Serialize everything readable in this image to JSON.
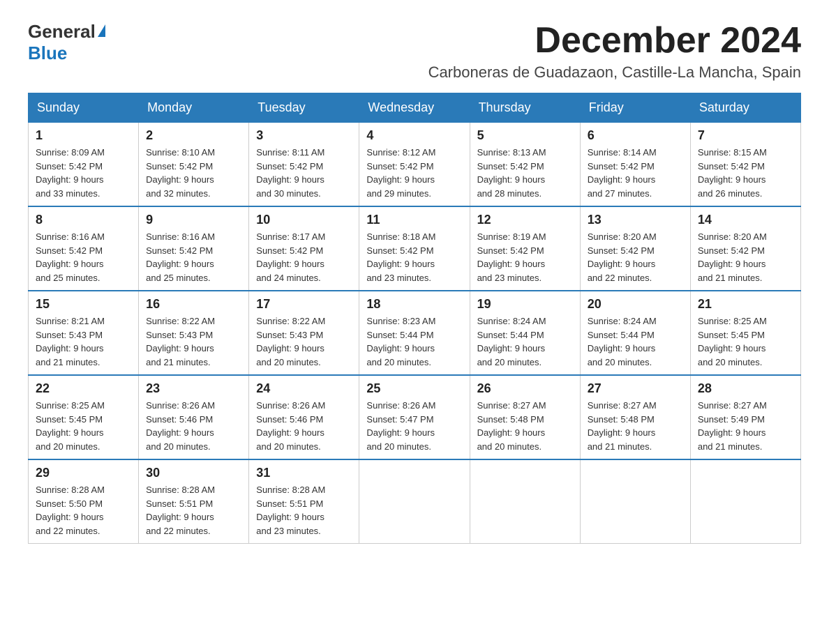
{
  "logo": {
    "general": "General",
    "blue": "Blue"
  },
  "header": {
    "title": "December 2024",
    "location": "Carboneras de Guadazaon, Castille-La Mancha, Spain"
  },
  "weekdays": [
    "Sunday",
    "Monday",
    "Tuesday",
    "Wednesday",
    "Thursday",
    "Friday",
    "Saturday"
  ],
  "weeks": [
    [
      {
        "day": "1",
        "sunrise": "8:09 AM",
        "sunset": "5:42 PM",
        "daylight": "9 hours and 33 minutes."
      },
      {
        "day": "2",
        "sunrise": "8:10 AM",
        "sunset": "5:42 PM",
        "daylight": "9 hours and 32 minutes."
      },
      {
        "day": "3",
        "sunrise": "8:11 AM",
        "sunset": "5:42 PM",
        "daylight": "9 hours and 30 minutes."
      },
      {
        "day": "4",
        "sunrise": "8:12 AM",
        "sunset": "5:42 PM",
        "daylight": "9 hours and 29 minutes."
      },
      {
        "day": "5",
        "sunrise": "8:13 AM",
        "sunset": "5:42 PM",
        "daylight": "9 hours and 28 minutes."
      },
      {
        "day": "6",
        "sunrise": "8:14 AM",
        "sunset": "5:42 PM",
        "daylight": "9 hours and 27 minutes."
      },
      {
        "day": "7",
        "sunrise": "8:15 AM",
        "sunset": "5:42 PM",
        "daylight": "9 hours and 26 minutes."
      }
    ],
    [
      {
        "day": "8",
        "sunrise": "8:16 AM",
        "sunset": "5:42 PM",
        "daylight": "9 hours and 25 minutes."
      },
      {
        "day": "9",
        "sunrise": "8:16 AM",
        "sunset": "5:42 PM",
        "daylight": "9 hours and 25 minutes."
      },
      {
        "day": "10",
        "sunrise": "8:17 AM",
        "sunset": "5:42 PM",
        "daylight": "9 hours and 24 minutes."
      },
      {
        "day": "11",
        "sunrise": "8:18 AM",
        "sunset": "5:42 PM",
        "daylight": "9 hours and 23 minutes."
      },
      {
        "day": "12",
        "sunrise": "8:19 AM",
        "sunset": "5:42 PM",
        "daylight": "9 hours and 23 minutes."
      },
      {
        "day": "13",
        "sunrise": "8:20 AM",
        "sunset": "5:42 PM",
        "daylight": "9 hours and 22 minutes."
      },
      {
        "day": "14",
        "sunrise": "8:20 AM",
        "sunset": "5:42 PM",
        "daylight": "9 hours and 21 minutes."
      }
    ],
    [
      {
        "day": "15",
        "sunrise": "8:21 AM",
        "sunset": "5:43 PM",
        "daylight": "9 hours and 21 minutes."
      },
      {
        "day": "16",
        "sunrise": "8:22 AM",
        "sunset": "5:43 PM",
        "daylight": "9 hours and 21 minutes."
      },
      {
        "day": "17",
        "sunrise": "8:22 AM",
        "sunset": "5:43 PM",
        "daylight": "9 hours and 20 minutes."
      },
      {
        "day": "18",
        "sunrise": "8:23 AM",
        "sunset": "5:44 PM",
        "daylight": "9 hours and 20 minutes."
      },
      {
        "day": "19",
        "sunrise": "8:24 AM",
        "sunset": "5:44 PM",
        "daylight": "9 hours and 20 minutes."
      },
      {
        "day": "20",
        "sunrise": "8:24 AM",
        "sunset": "5:44 PM",
        "daylight": "9 hours and 20 minutes."
      },
      {
        "day": "21",
        "sunrise": "8:25 AM",
        "sunset": "5:45 PM",
        "daylight": "9 hours and 20 minutes."
      }
    ],
    [
      {
        "day": "22",
        "sunrise": "8:25 AM",
        "sunset": "5:45 PM",
        "daylight": "9 hours and 20 minutes."
      },
      {
        "day": "23",
        "sunrise": "8:26 AM",
        "sunset": "5:46 PM",
        "daylight": "9 hours and 20 minutes."
      },
      {
        "day": "24",
        "sunrise": "8:26 AM",
        "sunset": "5:46 PM",
        "daylight": "9 hours and 20 minutes."
      },
      {
        "day": "25",
        "sunrise": "8:26 AM",
        "sunset": "5:47 PM",
        "daylight": "9 hours and 20 minutes."
      },
      {
        "day": "26",
        "sunrise": "8:27 AM",
        "sunset": "5:48 PM",
        "daylight": "9 hours and 20 minutes."
      },
      {
        "day": "27",
        "sunrise": "8:27 AM",
        "sunset": "5:48 PM",
        "daylight": "9 hours and 21 minutes."
      },
      {
        "day": "28",
        "sunrise": "8:27 AM",
        "sunset": "5:49 PM",
        "daylight": "9 hours and 21 minutes."
      }
    ],
    [
      {
        "day": "29",
        "sunrise": "8:28 AM",
        "sunset": "5:50 PM",
        "daylight": "9 hours and 22 minutes."
      },
      {
        "day": "30",
        "sunrise": "8:28 AM",
        "sunset": "5:51 PM",
        "daylight": "9 hours and 22 minutes."
      },
      {
        "day": "31",
        "sunrise": "8:28 AM",
        "sunset": "5:51 PM",
        "daylight": "9 hours and 23 minutes."
      },
      null,
      null,
      null,
      null
    ]
  ],
  "labels": {
    "sunrise": "Sunrise:",
    "sunset": "Sunset:",
    "daylight": "Daylight:"
  }
}
